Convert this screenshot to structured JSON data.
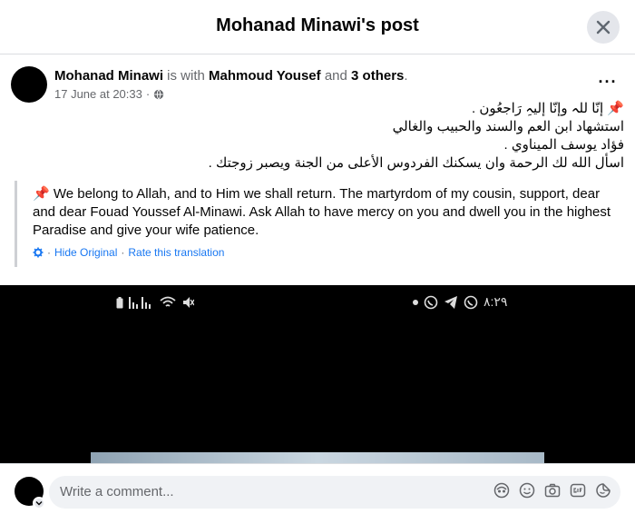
{
  "dialog": {
    "title": "Mohanad Minawi's post"
  },
  "post": {
    "author": "Mohanad Minawi",
    "is_with": "is with",
    "tagged": "Mahmoud Yousef",
    "and": "and",
    "others": "3 others",
    "period": ".",
    "date": "17 June at 20:33",
    "dot": "·",
    "more": "···",
    "arabic_lines": [
      "📌 إنّا للہ وإنّا إليہِ رَاجعُون .",
      "استشهاد ابن العم والسند والحبيب والغالي",
      "فؤاد يوسف الميناوي .",
      "اسأل الله لك الرحمة وان يسكنك الفردوس الأعلى من الجنة ويصبر زوجتك ."
    ],
    "translation": "📌 We belong to Allah, and to Him we shall return. The martyrdom of my cousin, support, dear and dear Fouad Youssef Al-Minawi. Ask Allah to have mercy on you and dwell you in the highest Paradise and give your wife patience.",
    "hide_original": "Hide Original",
    "rate_translation": "Rate this translation",
    "sep": "·"
  },
  "media": {
    "status_time": "٨:٢٩"
  },
  "comment": {
    "placeholder": "Write a comment..."
  },
  "colors": {
    "accent": "#1877f2",
    "secondary_text": "#65676b"
  }
}
